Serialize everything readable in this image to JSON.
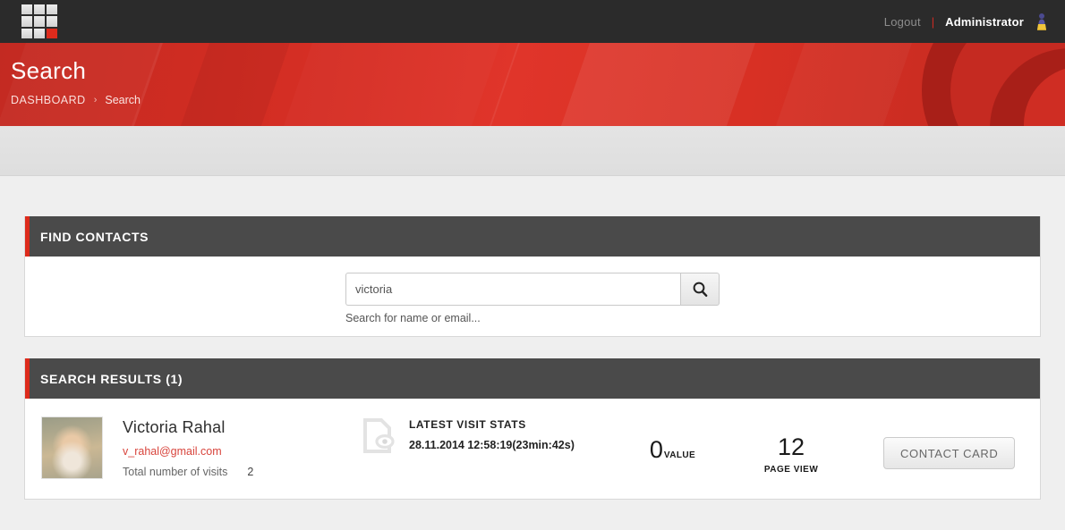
{
  "topbar": {
    "logo_name": "grid-logo",
    "logout_label": "Logout",
    "separator": "|",
    "admin_label": "Administrator",
    "avatar_icon": "user-avatar-icon"
  },
  "banner": {
    "title": "Search",
    "breadcrumb": {
      "root": "DASHBOARD",
      "chevron": "›",
      "current": "Search"
    },
    "colors": {
      "red_primary": "#dd2b1c",
      "red_dark": "#a81f18",
      "bar_dark": "#2b2b2b"
    }
  },
  "find_contacts": {
    "panel_title": "FIND CONTACTS",
    "search_value": "victoria",
    "search_placeholder": "Search for name or email...",
    "search_icon": "search-icon",
    "hint": "Search for name or email..."
  },
  "search_results": {
    "panel_title": "SEARCH RESULTS (1)",
    "rows": [
      {
        "avatar": "contact-photo",
        "name": "Victoria Rahal",
        "email": "v_rahal@gmail.com",
        "visits_label": "Total number of visits",
        "visits_count": "2",
        "stats_icon": "document-eye-icon",
        "stats_title": "LATEST VISIT STATS",
        "stats_date": "28.11.2014 12:58:19(23min:42s)",
        "value_number": "0",
        "value_label": "VALUE",
        "pageview_number": "12",
        "pageview_label": "PAGE VIEW",
        "action_label": "CONTACT CARD"
      }
    ]
  }
}
